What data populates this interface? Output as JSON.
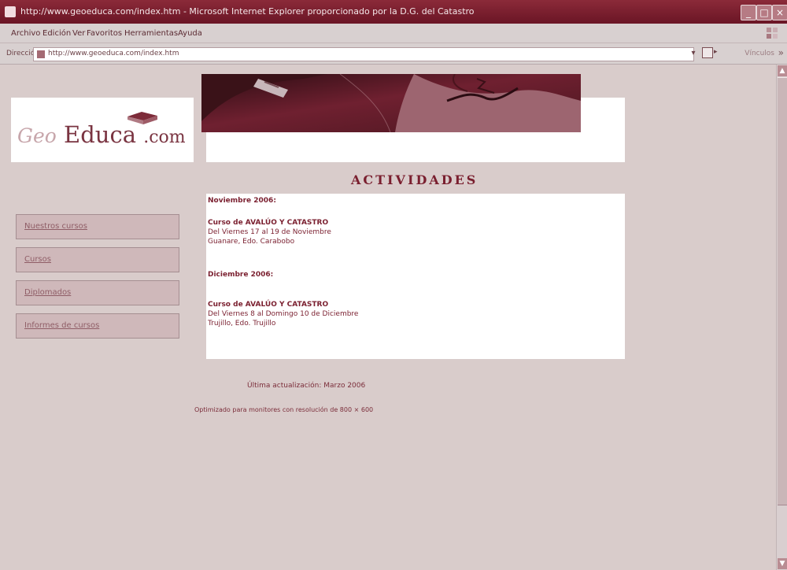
{
  "browser": {
    "title": "http://www.geoeduca.com/index.htm - Microsoft Internet Explorer proporcionado por la D.G. del Catastro",
    "menu": [
      "Archivo",
      "Edición",
      "Ver",
      "Favoritos",
      "Herramientas",
      "Ayuda"
    ],
    "address_label": "Dirección",
    "url": "http://www.geoeduca.com/index.htm",
    "links_label": "Vínculos"
  },
  "site": {
    "logo_geo": "Geo",
    "logo_educa": "Educa",
    "logo_com": ".com",
    "section_title": "ACTIVIDADES",
    "nav": [
      "Nuestros cursos",
      "Cursos",
      "Diplomados",
      "Informes de cursos"
    ],
    "activities": {
      "month_1": "Noviembre 2006:",
      "course_1_title": "Curso de AVALÚO Y CATASTRO",
      "course_1_date": "Del Viernes 17 al 19 de Noviembre",
      "course_1_place": "Guanare, Edo. Carabobo",
      "month_2": "Diciembre 2006:",
      "course_2_title": "Curso de AVALÚO Y CATASTRO",
      "course_2_date": "Del Viernes 8 al Domingo 10 de Diciembre",
      "course_2_place": "Trujillo, Edo. Trujillo"
    },
    "footer_updated": "Última actualización: Marzo 2006",
    "footer_resolution": "Optimizado para monitores con resolución de 800 × 600"
  }
}
